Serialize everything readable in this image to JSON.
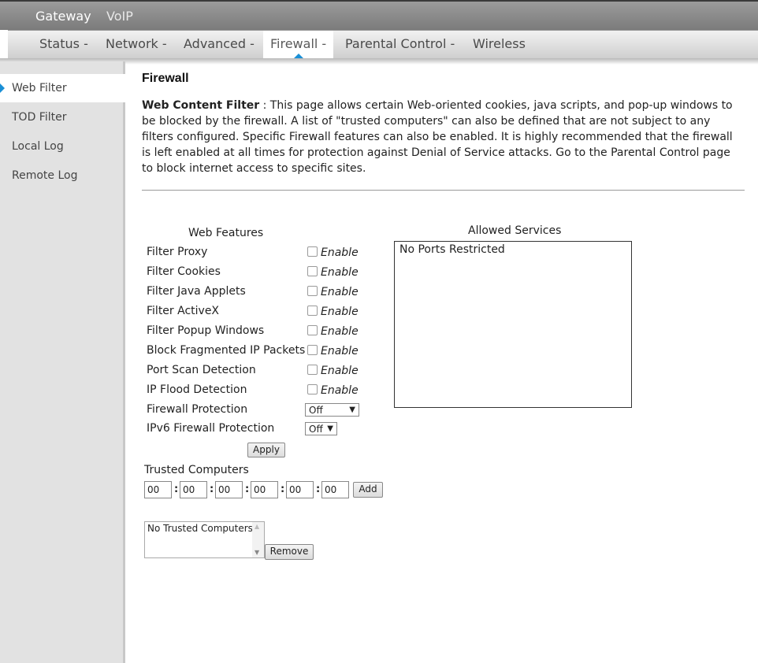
{
  "topbar": {
    "gateway": "Gateway",
    "voip": "VoIP"
  },
  "menu": {
    "status": "Status -",
    "network": "Network -",
    "advanced": "Advanced -",
    "firewall": "Firewall -",
    "parental": "Parental Control -",
    "wireless": "Wireless"
  },
  "sidebar": {
    "items": [
      "Web Filter",
      "TOD Filter",
      "Local Log",
      "Remote Log"
    ]
  },
  "page": {
    "title": "Firewall",
    "heading": "Web Content Filter",
    "description": "  :  This page allows certain Web-oriented cookies, java scripts, and pop-up windows to be blocked by the firewall. A list of \"trusted computers\" can also be defined that are not subject to any filters configured. Specific Firewall features can also be enabled. It is highly recommended that the firewall is left enabled at all times for protection against Denial of Service attacks. Go to the Parental Control page to block internet access to specific sites."
  },
  "web_features": {
    "header": "Web Features",
    "enable_label": "Enable",
    "items": [
      "Filter Proxy",
      "Filter Cookies",
      "Filter Java Applets",
      "Filter ActiveX",
      "Filter Popup Windows",
      "Block Fragmented IP Packets",
      "Port Scan Detection",
      "IP Flood Detection"
    ],
    "firewall_protection": {
      "label": "Firewall Protection",
      "value": "Off"
    },
    "ipv6_firewall_protection": {
      "label": "IPv6 Firewall Protection",
      "value": "Off"
    },
    "apply_label": "Apply"
  },
  "allowed_services": {
    "header": "Allowed Services",
    "content": "No Ports Restricted"
  },
  "trusted": {
    "label": "Trusted Computers",
    "mac": [
      "00",
      "00",
      "00",
      "00",
      "00",
      "00"
    ],
    "separator": ":",
    "add_label": "Add",
    "list_content": "No Trusted Computers",
    "remove_label": "Remove"
  },
  "colors": {
    "accent": "#1a8fd6",
    "sidebar_bg": "#e2e2e2",
    "topbar_bg": "#8a8a8a"
  }
}
